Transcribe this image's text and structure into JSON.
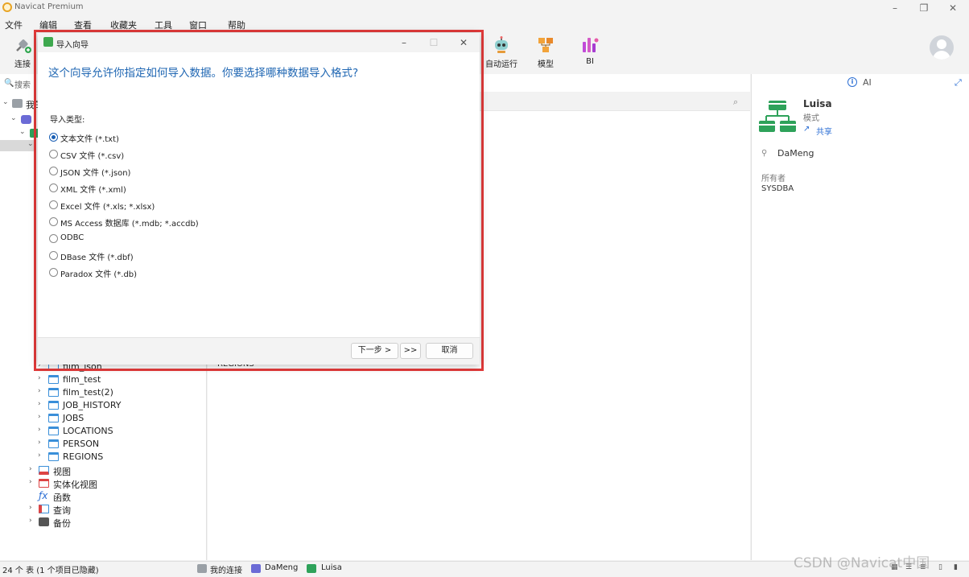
{
  "app": {
    "title": "Navicat Premium"
  },
  "menu": [
    "文件",
    "编辑",
    "查看",
    "收藏夹",
    "工具",
    "窗口",
    "帮助"
  ],
  "toolbar": {
    "connect": "连接",
    "automation": "自动运行",
    "model": "模型",
    "bi": "BI"
  },
  "nav": {
    "search_placeholder": "搜索",
    "tree": {
      "my_connections": "我的连接",
      "tables": [
        "film_json",
        "film_test",
        "film_test(2)",
        "JOB_HISTORY",
        "JOBS",
        "LOCATIONS",
        "PERSON",
        "REGIONS"
      ],
      "views": "视图",
      "materialized_views": "实体化视图",
      "functions": "函数",
      "queries": "查询",
      "backups": "备份"
    }
  },
  "content": {
    "visible_row": "REGIONS"
  },
  "right_panel": {
    "ai_label": "AI",
    "schema_name": "Luisa",
    "schema_type": "模式",
    "share_label": "共享",
    "connection_name": "DaMeng",
    "owner_title": "所有者",
    "owner_value": "SYSDBA"
  },
  "status": {
    "text": "24 个 表 (1 个项目已隐藏)",
    "connection_group": "我的连接",
    "connection": "DaMeng",
    "schema": "Luisa"
  },
  "watermark": "CSDN @Navicat中国",
  "dialog": {
    "title": "导入向导",
    "heading": "这个向导允许你指定如何导入数据。你要选择哪种数据导入格式?",
    "import_type_label": "导入类型:",
    "options": [
      {
        "label": "文本文件 (*.txt)",
        "selected": true
      },
      {
        "label": "CSV 文件 (*.csv)",
        "selected": false
      },
      {
        "label": "JSON 文件 (*.json)",
        "selected": false
      },
      {
        "label": "XML 文件 (*.xml)",
        "selected": false
      },
      {
        "label": "Excel 文件 (*.xls; *.xlsx)",
        "selected": false
      },
      {
        "label": "MS Access 数据库 (*.mdb; *.accdb)",
        "selected": false
      },
      {
        "label": "ODBC",
        "selected": false
      },
      {
        "label": "DBase 文件 (*.dbf)",
        "selected": false
      },
      {
        "label": "Paradox 文件 (*.db)",
        "selected": false
      }
    ],
    "buttons": {
      "next": "下一步 >",
      "finish": ">>",
      "cancel": "取消"
    }
  },
  "colors": {
    "highlight_border": "#e23a3a",
    "heading_blue": "#2067b3",
    "accent_blue": "#2d6fd4",
    "schema_green": "#2ea25a"
  }
}
